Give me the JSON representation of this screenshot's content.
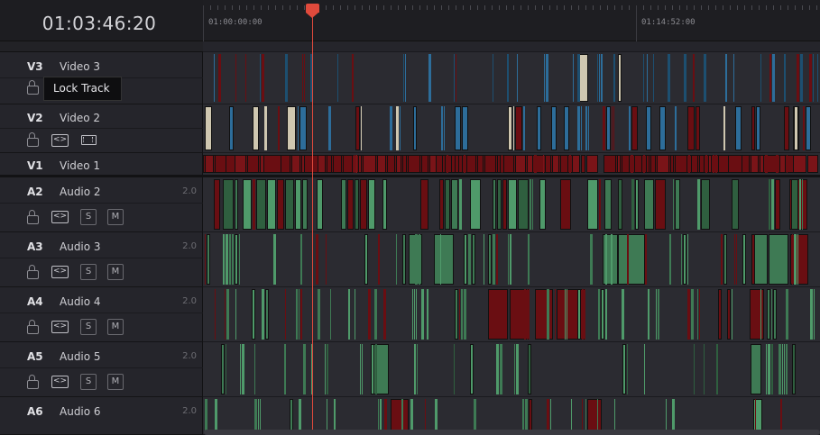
{
  "timecode": "01:03:46:20",
  "ruler": {
    "start_label": "01:00:00:00",
    "mark_label": "01:14:52:00"
  },
  "tooltip": "Lock Track",
  "tracks": [
    {
      "id": "V3",
      "name": "Video 3",
      "kind": "video",
      "channels": ""
    },
    {
      "id": "V2",
      "name": "Video 2",
      "kind": "video",
      "channels": ""
    },
    {
      "id": "V1",
      "name": "Video 1",
      "kind": "video",
      "channels": ""
    },
    {
      "id": "A2",
      "name": "Audio 2",
      "kind": "audio",
      "channels": "2.0"
    },
    {
      "id": "A3",
      "name": "Audio 3",
      "kind": "audio",
      "channels": "2.0"
    },
    {
      "id": "A4",
      "name": "Audio 4",
      "kind": "audio",
      "channels": "2.0"
    },
    {
      "id": "A5",
      "name": "Audio 5",
      "kind": "audio",
      "channels": "2.0"
    },
    {
      "id": "A6",
      "name": "Audio 6",
      "kind": "audio",
      "channels": "2.0"
    }
  ],
  "buttons": {
    "solo": "S",
    "mute": "M",
    "auto_select": "<>"
  },
  "colors": {
    "playhead": "#e04a3c",
    "video_blue": "#2d6d9a",
    "video_cream": "#cfc7b0",
    "clip_red": "#6a0e12",
    "clip_green": "#3e7a54",
    "audio_green_line": "#4f9a6a"
  }
}
